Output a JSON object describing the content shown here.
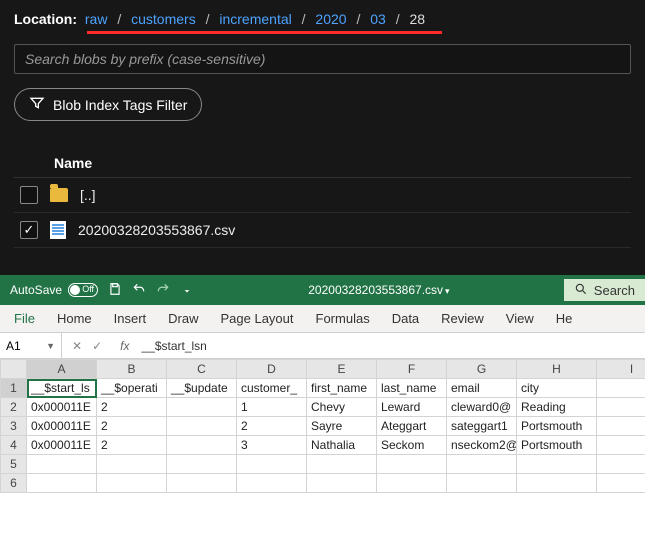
{
  "portal": {
    "location_label": "Location:",
    "crumbs": [
      "raw",
      "customers",
      "incremental",
      "2020",
      "03",
      "28"
    ],
    "search_placeholder": "Search blobs by prefix (case-sensitive)",
    "filter_label": "Blob Index Tags Filter",
    "name_header": "Name",
    "rows": [
      {
        "checked": false,
        "type": "folder",
        "name": "[..]"
      },
      {
        "checked": true,
        "type": "file",
        "name": "20200328203553867.csv"
      }
    ]
  },
  "excel": {
    "autosave_label": "AutoSave",
    "autosave_state": "Off",
    "filename": "20200328203553867.csv",
    "search_label": "Search",
    "tabs": [
      "File",
      "Home",
      "Insert",
      "Draw",
      "Page Layout",
      "Formulas",
      "Data",
      "Review",
      "View",
      "He"
    ],
    "namebox": "A1",
    "fx_value": "__$start_lsn",
    "columns": [
      "A",
      "B",
      "C",
      "D",
      "E",
      "F",
      "G",
      "H",
      "I"
    ],
    "row_numbers": [
      "1",
      "2",
      "3",
      "4",
      "5",
      "6"
    ],
    "cells": [
      [
        "__$start_ls",
        "__$operati",
        "__$update",
        "customer_",
        "first_name",
        "last_name",
        "email",
        "city",
        ""
      ],
      [
        "0x000011E",
        "2",
        "",
        "1",
        "Chevy",
        "Leward",
        "cleward0@",
        "Reading",
        ""
      ],
      [
        "0x000011E",
        "2",
        "",
        "2",
        "Sayre",
        "Ateggart",
        "sateggart1",
        "Portsmouth",
        ""
      ],
      [
        "0x000011E",
        "2",
        "",
        "3",
        "Nathalia",
        "Seckom",
        "nseckom2@",
        "Portsmouth",
        ""
      ],
      [
        "",
        "",
        "",
        "",
        "",
        "",
        "",
        "",
        ""
      ],
      [
        "",
        "",
        "",
        "",
        "",
        "",
        "",
        "",
        ""
      ]
    ],
    "selected": {
      "row": 0,
      "col": 0
    }
  }
}
